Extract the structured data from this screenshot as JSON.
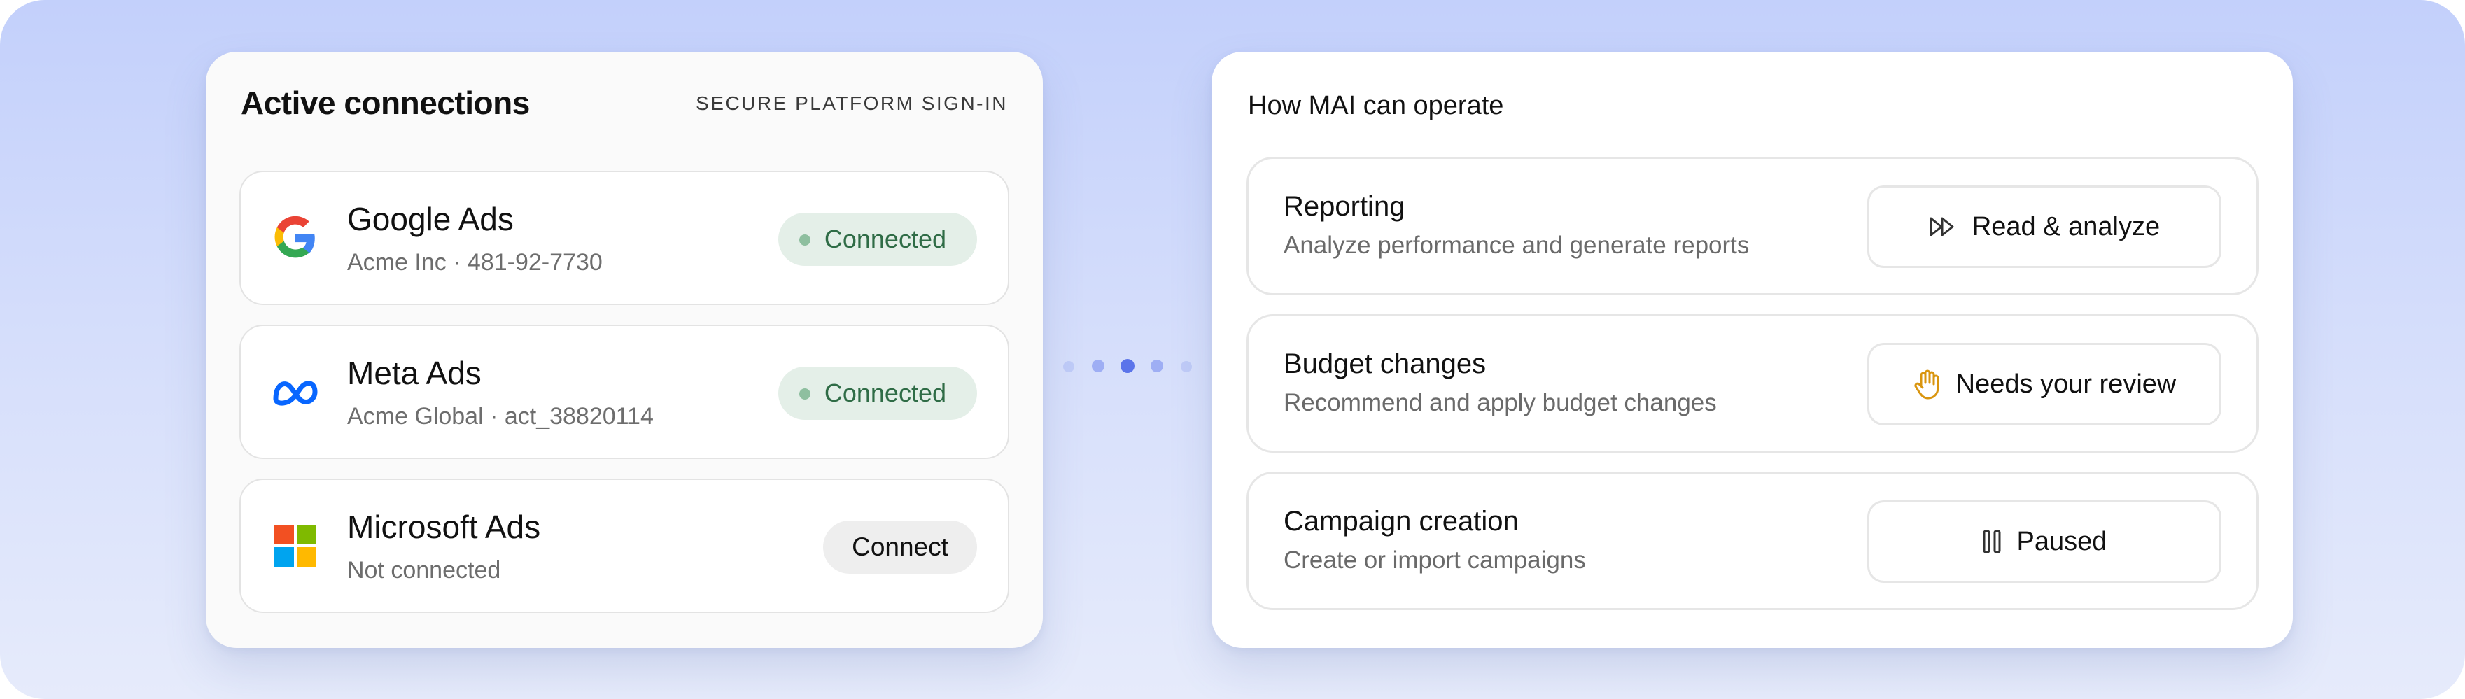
{
  "connections_panel": {
    "title": "Active connections",
    "tag": "SECURE PLATFORM SIGN-IN",
    "items": [
      {
        "name": "Google Ads",
        "account": "Acme Inc · 481-92-7730",
        "status": "Connected",
        "icon": "google-logo-icon"
      },
      {
        "name": "Meta Ads",
        "account": "Acme Global · act_38820114",
        "status": "Connected",
        "icon": "meta-logo-icon"
      },
      {
        "name": "Microsoft Ads",
        "account": "Not connected",
        "action": "Connect",
        "icon": "microsoft-logo-icon"
      }
    ]
  },
  "operate_panel": {
    "title": "How MAI can operate",
    "items": [
      {
        "name": "Reporting",
        "description": "Analyze performance and generate reports",
        "mode": "Read & analyze",
        "icon": "fast-forward-icon"
      },
      {
        "name": "Budget changes",
        "description": "Recommend and apply budget changes",
        "mode": "Needs your review",
        "icon": "hand-icon"
      },
      {
        "name": "Campaign creation",
        "description": "Create or import campaigns",
        "mode": "Paused",
        "icon": "pause-icon"
      }
    ]
  },
  "colors": {
    "background_top": "#c3d0fb",
    "background_bottom": "#e6ebfb",
    "connected_bg": "#e4efe8",
    "connected_text": "#2f6c46",
    "review_icon": "#d9950f",
    "dots": "#5b74ea"
  }
}
